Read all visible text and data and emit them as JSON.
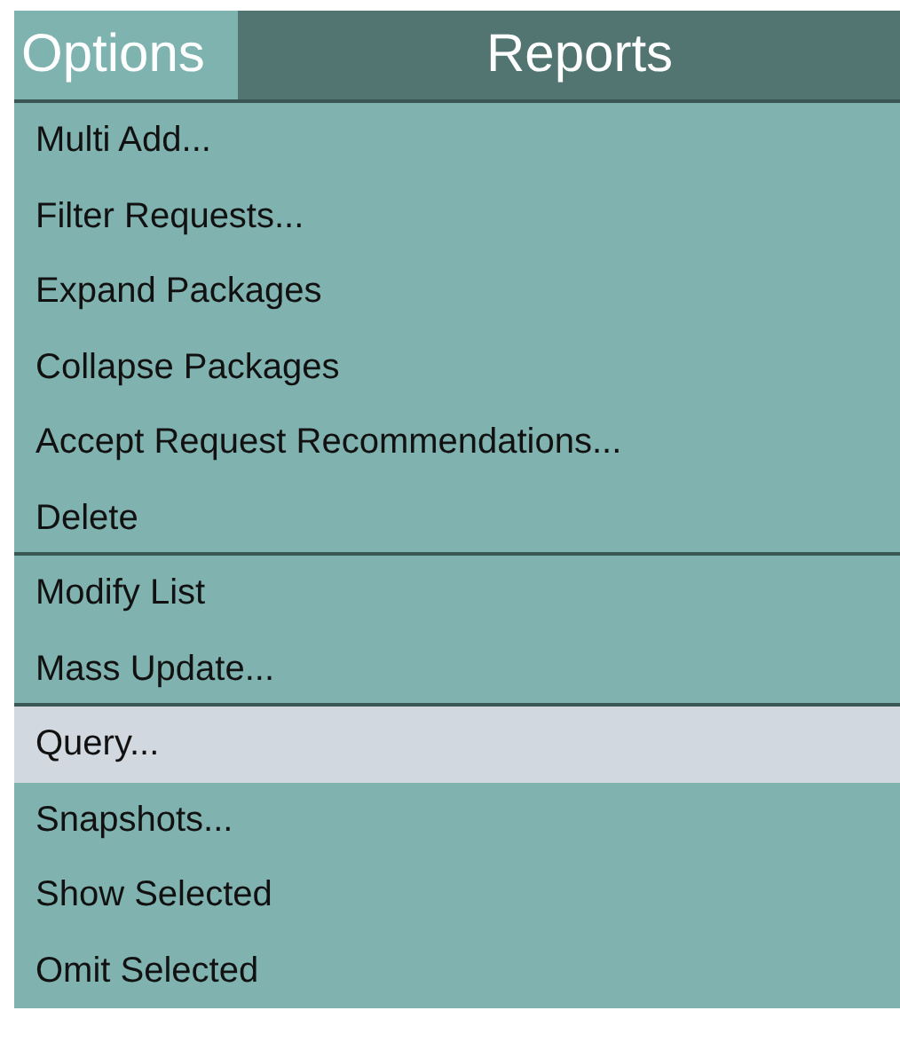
{
  "menubar": [
    {
      "label": "Options",
      "selected": true
    },
    {
      "label": "Reports",
      "selected": false
    }
  ],
  "menu": {
    "items": [
      {
        "label": "Multi Add...",
        "selected": false,
        "separator_after": false
      },
      {
        "label": "Filter Requests...",
        "selected": false,
        "separator_after": false
      },
      {
        "label": "Expand Packages",
        "selected": false,
        "separator_after": false
      },
      {
        "label": "Collapse Packages",
        "selected": false,
        "separator_after": false
      },
      {
        "label": "Accept Request Recommendations...",
        "selected": false,
        "separator_after": false
      },
      {
        "label": "Delete",
        "selected": false,
        "separator_after": true
      },
      {
        "label": "Modify List",
        "selected": false,
        "separator_after": false
      },
      {
        "label": "Mass Update...",
        "selected": false,
        "separator_after": true
      },
      {
        "label": "Query...",
        "selected": true,
        "separator_after": false
      },
      {
        "label": "Snapshots...",
        "selected": false,
        "separator_after": false
      },
      {
        "label": "Show Selected",
        "selected": false,
        "separator_after": false
      },
      {
        "label": "Omit Selected",
        "selected": false,
        "separator_after": false
      }
    ]
  }
}
